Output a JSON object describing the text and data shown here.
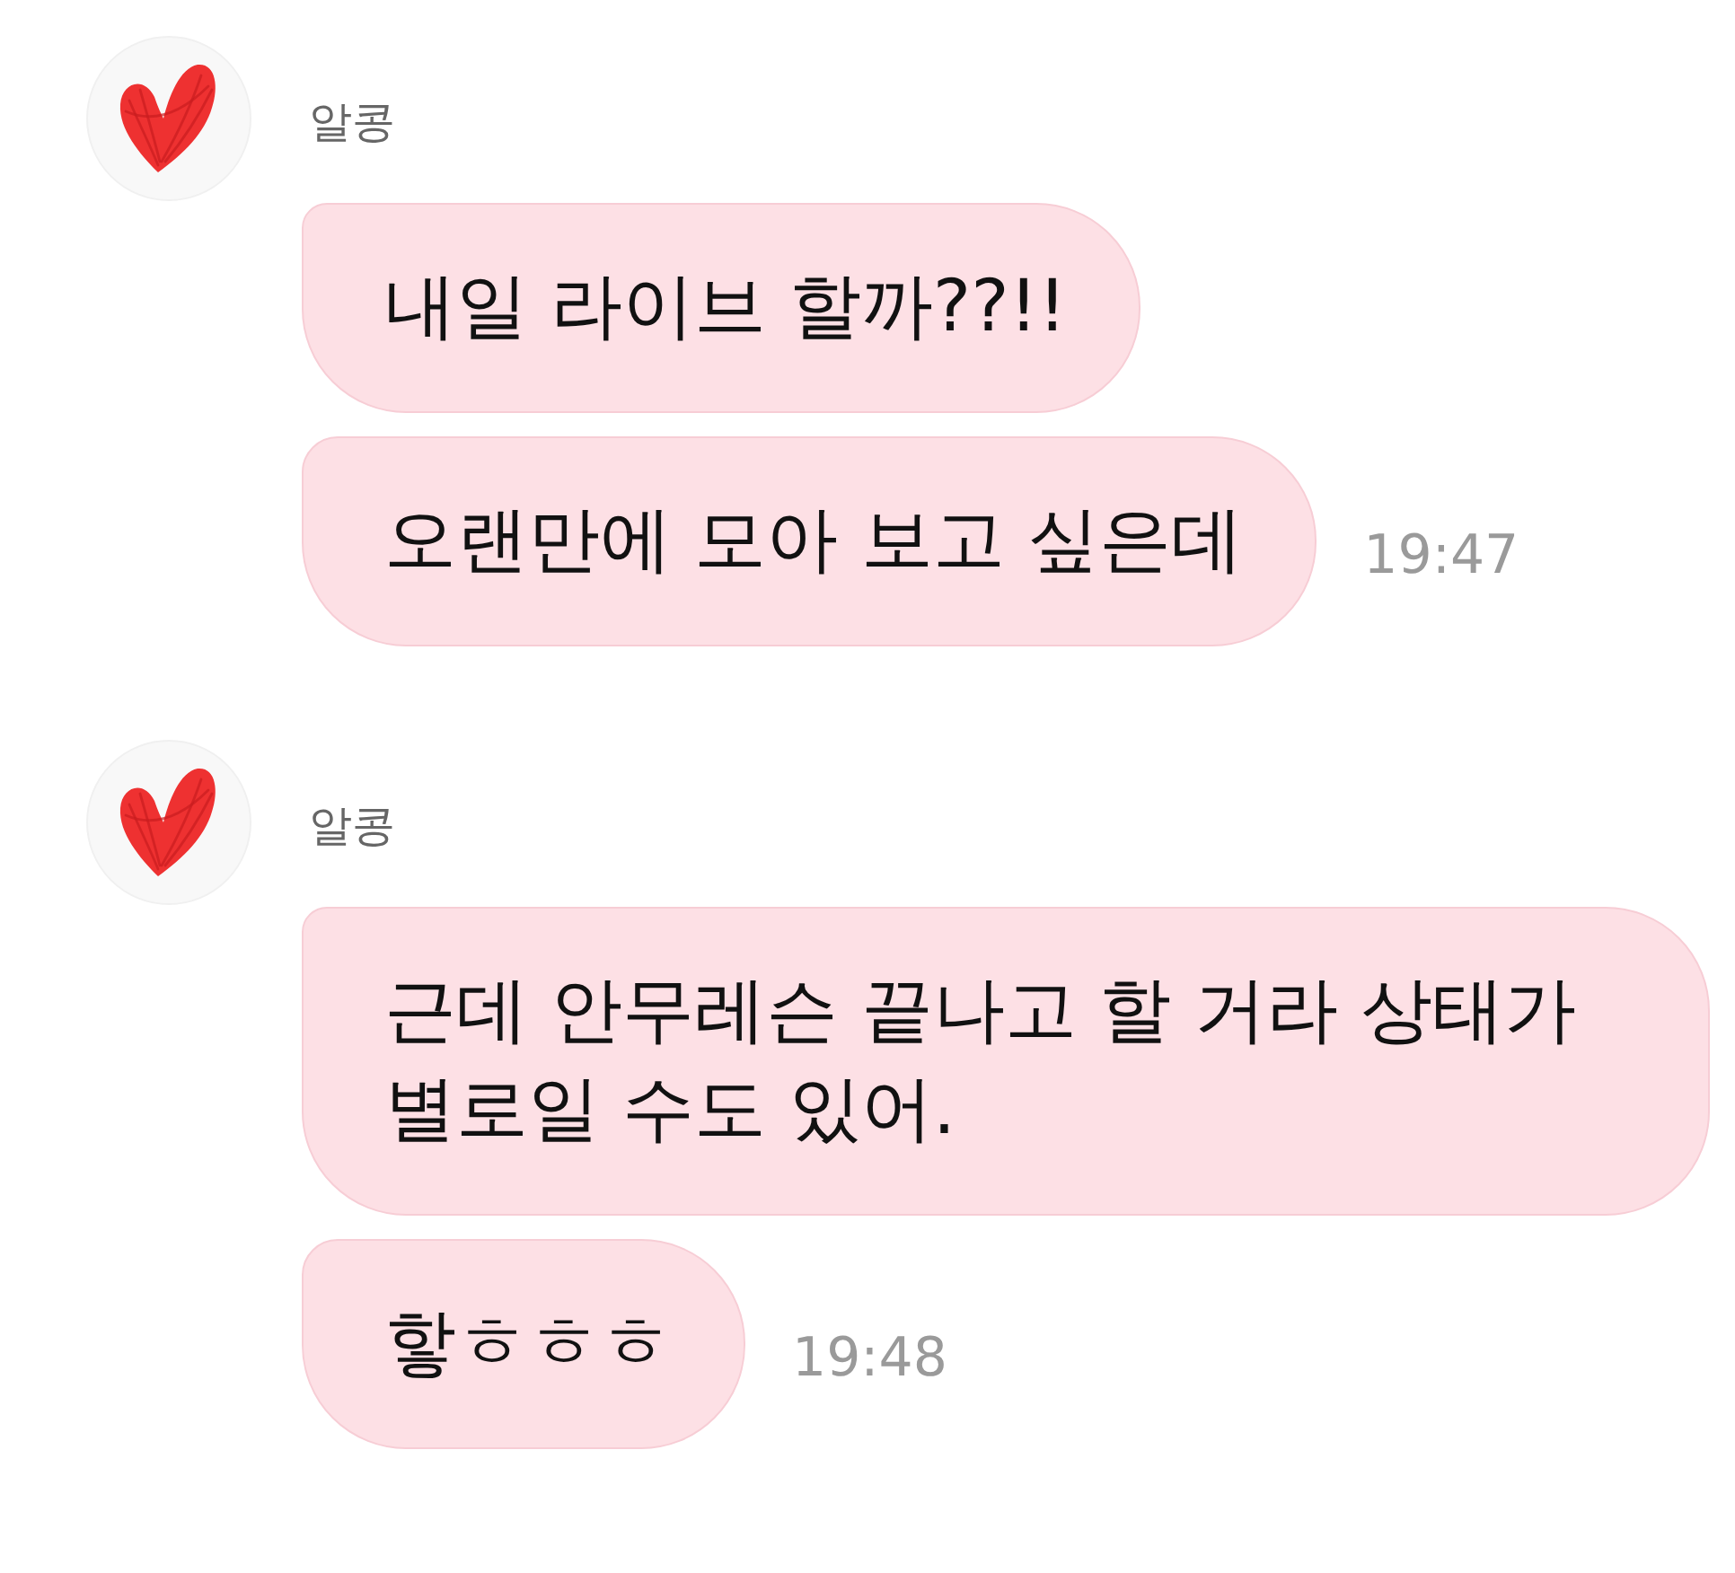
{
  "conversation": [
    {
      "sender": "알콩",
      "messages": [
        {
          "text": "내일 라이브 할까??!!"
        },
        {
          "text": "오랜만에 모아 보고 싶은데",
          "time": "19:47"
        }
      ]
    },
    {
      "sender": "알콩",
      "messages": [
        {
          "text": "근데 안무레슨 끝나고 할 거라 상태가 별로일 수도 있어."
        },
        {
          "text": "핳ㅎㅎㅎ",
          "time": "19:48"
        }
      ]
    }
  ]
}
